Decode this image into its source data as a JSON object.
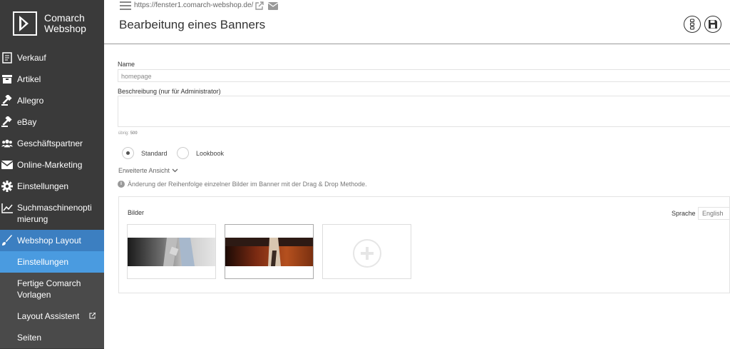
{
  "app": {
    "logo_line1": "Comarch",
    "logo_line2": "Webshop"
  },
  "sidebar": {
    "items": [
      {
        "label": "Verkauf",
        "icon": "receipt-icon"
      },
      {
        "label": "Artikel",
        "icon": "box-icon"
      },
      {
        "label": "Allegro",
        "icon": "gavel-icon"
      },
      {
        "label": "eBay",
        "icon": "gavel-icon"
      },
      {
        "label": "Geschäftspartner",
        "icon": "users-icon"
      },
      {
        "label": "Online-Marketing",
        "icon": "envelope-icon"
      },
      {
        "label": "Einstellungen",
        "icon": "gear-icon"
      },
      {
        "label": "Suchmaschinenoptimierung",
        "icon": "chart-line-icon"
      },
      {
        "label": "Webshop Layout",
        "icon": "brush-icon"
      }
    ],
    "subitems": [
      {
        "label": "Einstellungen"
      },
      {
        "label": "Fertige Comarch Vorlagen"
      },
      {
        "label": "Layout Assistent"
      },
      {
        "label": "Seiten"
      }
    ]
  },
  "header": {
    "url": "https://fenster1.comarch-webshop.de/",
    "title": "Bearbeitung eines Banners"
  },
  "form": {
    "name_label": "Name",
    "name_value": "homepage",
    "desc_label": "Beschreibung (nur für Administrator)",
    "desc_value": "",
    "remaining_label": "übrig:",
    "remaining_value": "500",
    "radio_standard": "Standard",
    "radio_lookbook": "Lookbook",
    "selected_mode": "Standard",
    "advanced_view": "Erweiterte Ansicht",
    "info_text": "Änderung der Reihenfolge einzelner Bilder im Banner mit der Drag & Drop Methode."
  },
  "images_panel": {
    "title": "Bilder",
    "language_label": "Sprache",
    "language_value": "English"
  },
  "colors": {
    "sidebar_bg": "#3a3a3a",
    "active": "#3c7fc1",
    "sub_active": "#4a9be0"
  }
}
